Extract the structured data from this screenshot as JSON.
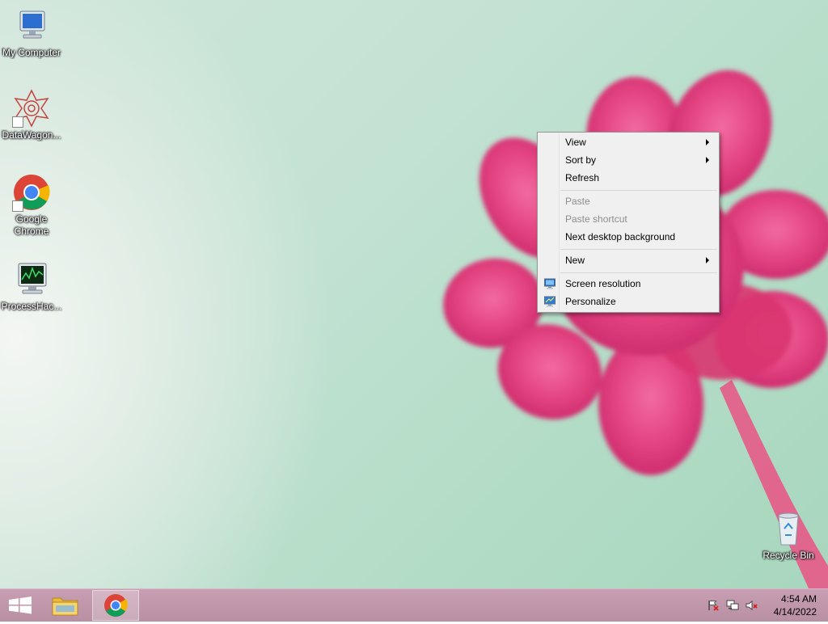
{
  "desktop": {
    "icons": [
      {
        "label": "My Computer"
      },
      {
        "label": "DataWagon..."
      },
      {
        "label": "Google Chrome"
      },
      {
        "label": "ProcessHac..."
      },
      {
        "label": "Recycle Bin"
      }
    ]
  },
  "context_menu": {
    "items": [
      {
        "label": "View",
        "submenu": true,
        "enabled": true
      },
      {
        "label": "Sort by",
        "submenu": true,
        "enabled": true
      },
      {
        "label": "Refresh",
        "enabled": true
      },
      {
        "label": "Paste",
        "enabled": false
      },
      {
        "label": "Paste shortcut",
        "enabled": false
      },
      {
        "label": "Next desktop background",
        "enabled": true
      },
      {
        "label": "New",
        "submenu": true,
        "enabled": true
      },
      {
        "label": "Screen resolution",
        "icon": "monitor-icon",
        "enabled": true
      },
      {
        "label": "Personalize",
        "icon": "personalize-icon",
        "enabled": true
      }
    ]
  },
  "taskbar": {
    "buttons": [
      {
        "name": "start",
        "icon": "windows-logo-icon"
      },
      {
        "name": "file-explorer",
        "icon": "folder-icon"
      },
      {
        "name": "google-chrome",
        "icon": "chrome-icon",
        "active": true
      }
    ],
    "tray": {
      "icons": [
        "action-center-flag-icon",
        "network-icon",
        "volume-muted-icon"
      ],
      "time": "4:54 AM",
      "date": "4/14/2022"
    }
  },
  "colors": {
    "taskbar": "#c09aad",
    "menu_background": "#f0f0f0",
    "flower_pink": "#e8407f"
  }
}
